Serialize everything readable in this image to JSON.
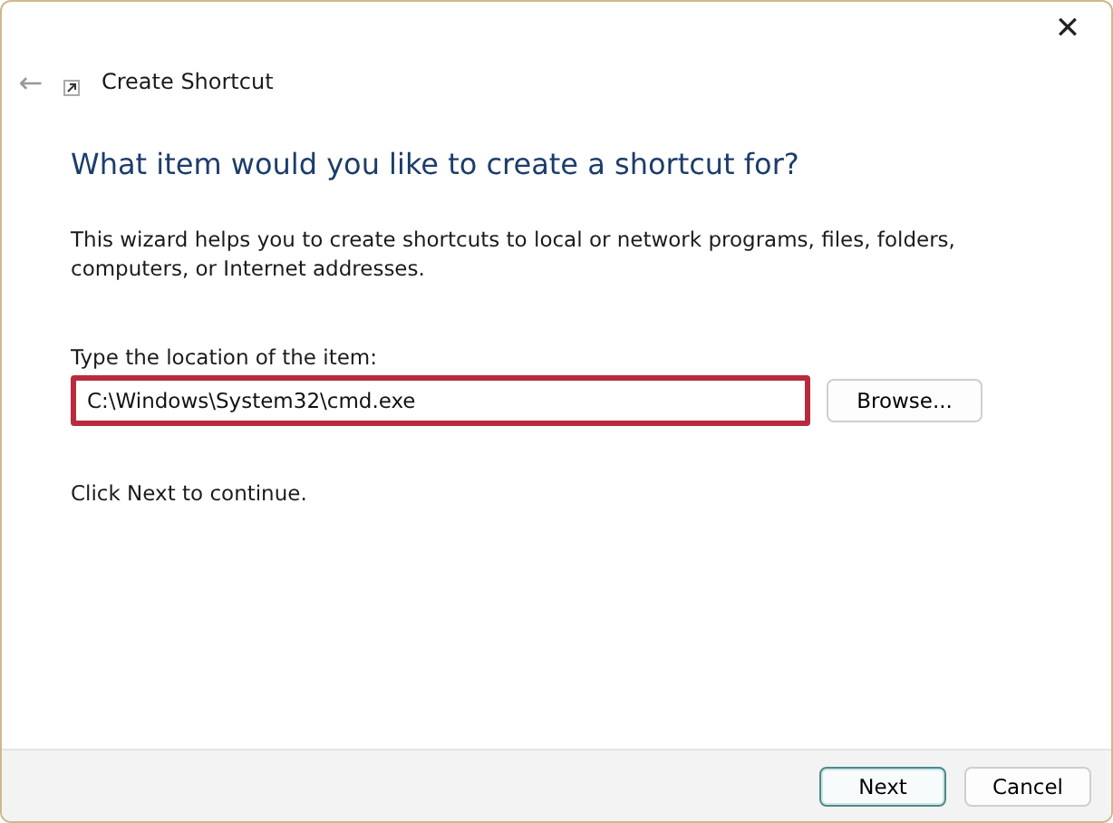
{
  "window": {
    "title": "Create Shortcut",
    "close": "✕",
    "back": "←"
  },
  "heading": "What item would you like to create a shortcut for?",
  "description": "This wizard helps you to create shortcuts to local or network programs, files, folders, computers, or Internet addresses.",
  "location": {
    "label": "Type the location of the item:",
    "value": "C:\\Windows\\System32\\cmd.exe",
    "highlighted": true,
    "browse": "Browse..."
  },
  "hint": "Click Next to continue.",
  "buttons": [
    {
      "label": "Next",
      "default": true
    },
    {
      "label": "Cancel",
      "default": false
    }
  ]
}
